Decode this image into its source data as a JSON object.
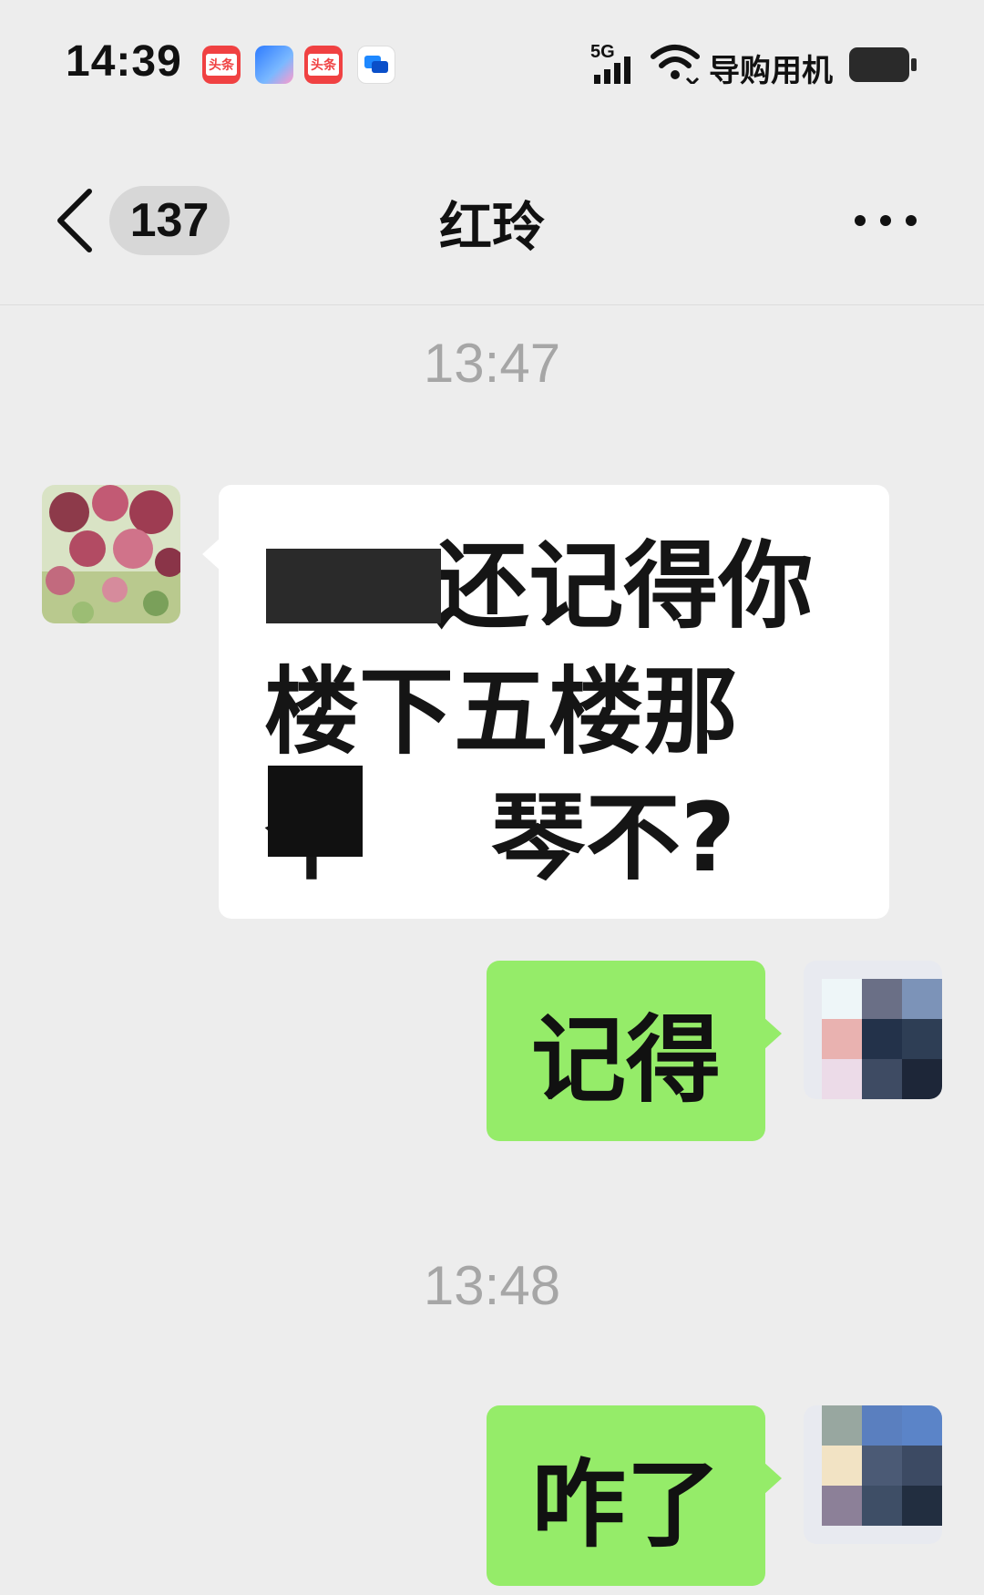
{
  "status_bar": {
    "time": "14:39",
    "network": "5G",
    "carrier": "导购用机",
    "icons": [
      "toutiao-icon",
      "shopping-bag-icon",
      "toutiao-icon",
      "chat-app-icon",
      "signal-icon",
      "wifi-icon",
      "battery-icon"
    ],
    "toutiao_label": "头条"
  },
  "nav": {
    "unread_count": "137",
    "title": "红玲"
  },
  "messages": [
    {
      "type": "time",
      "text": "13:47"
    },
    {
      "type": "incoming",
      "text": "    :还记得你楼下五楼那个    琴不?",
      "redacted": true
    },
    {
      "type": "outgoing",
      "text": "记得"
    },
    {
      "type": "time",
      "text": "13:48"
    },
    {
      "type": "outgoing",
      "text": "咋了"
    }
  ],
  "colors": {
    "background": "#ededed",
    "incoming_bubble": "#ffffff",
    "outgoing_bubble": "#95ec69",
    "timestamp": "#a6a6a6"
  }
}
